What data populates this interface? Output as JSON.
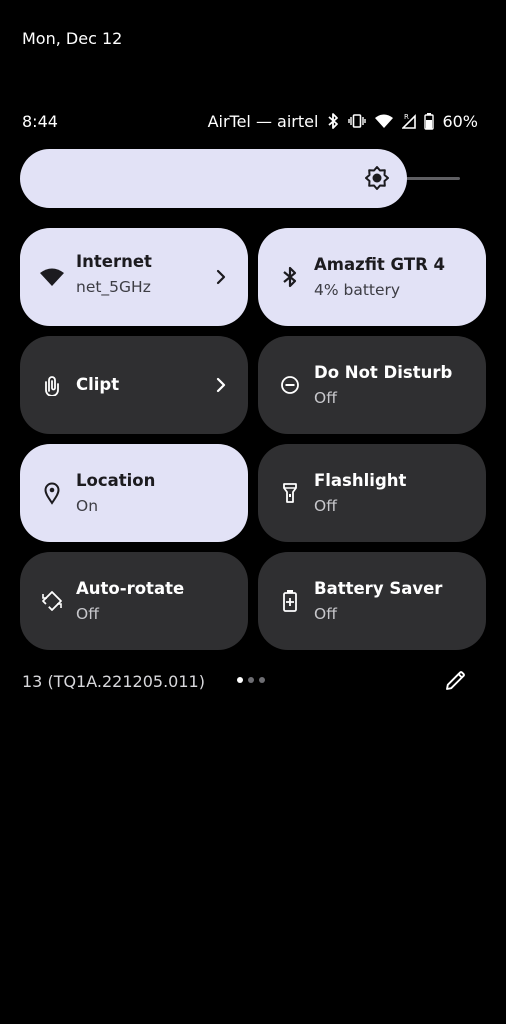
{
  "header": {
    "date": "Mon, Dec 12"
  },
  "status_bar": {
    "time": "8:44",
    "carrier": "AirTel — airtel",
    "battery_percent": "60%",
    "icons": [
      "bluetooth-icon",
      "vibrate-icon",
      "wifi-icon",
      "cell-signal-icon",
      "battery-icon"
    ]
  },
  "brightness": {
    "level_fraction": 0.83,
    "icon": "brightness-icon"
  },
  "tiles": [
    {
      "id": "internet",
      "title": "Internet",
      "subtitle": "net_5GHz",
      "state": "on",
      "icon": "wifi-icon",
      "has_chevron": true
    },
    {
      "id": "bluetooth",
      "title": "Amazfit GTR 4",
      "subtitle": "4% battery",
      "state": "on",
      "icon": "bluetooth-icon",
      "has_chevron": false
    },
    {
      "id": "clipt",
      "title": "Clipt",
      "subtitle": "",
      "state": "off",
      "icon": "clip-icon",
      "has_chevron": true
    },
    {
      "id": "dnd",
      "title": "Do Not Disturb",
      "subtitle": "Off",
      "state": "off",
      "icon": "dnd-icon",
      "has_chevron": false
    },
    {
      "id": "location",
      "title": "Location",
      "subtitle": "On",
      "state": "on",
      "icon": "location-icon",
      "has_chevron": false
    },
    {
      "id": "flashlight",
      "title": "Flashlight",
      "subtitle": "Off",
      "state": "off",
      "icon": "flashlight-icon",
      "has_chevron": false
    },
    {
      "id": "autorotate",
      "title": "Auto-rotate",
      "subtitle": "Off",
      "state": "off",
      "icon": "rotate-icon",
      "has_chevron": false
    },
    {
      "id": "batterysaver",
      "title": "Battery Saver",
      "subtitle": "Off",
      "state": "off",
      "icon": "battery-saver-icon",
      "has_chevron": false
    }
  ],
  "footer": {
    "build_number": "13 (TQ1A.221205.011)",
    "page_count": 3,
    "active_page": 1,
    "edit_icon": "pencil-icon"
  },
  "colors": {
    "background": "#000000",
    "tile_on": "#e2e2f6",
    "tile_off": "#2f2f31"
  }
}
